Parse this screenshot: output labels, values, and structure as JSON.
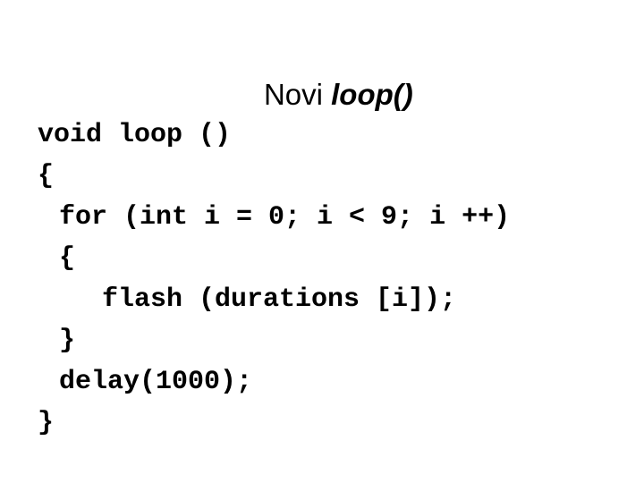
{
  "slide": {
    "title": {
      "plain_text": "Novi ",
      "emphasized_text": "loop()",
      "full_text": "Novi loop()"
    },
    "code": {
      "language": "arduino-c",
      "lines": [
        {
          "text": "void loop ()",
          "indent": 0
        },
        {
          "text": "{",
          "indent": 0
        },
        {
          "text": "for (int i = 0; i < 9; i ++)",
          "indent": 1
        },
        {
          "text": "{",
          "indent": 1
        },
        {
          "text": "flash (durations [i]);",
          "indent": 2
        },
        {
          "text": "}",
          "indent": 1
        },
        {
          "text": "delay(1000);",
          "indent": 1
        },
        {
          "text": "}",
          "indent": 0
        }
      ]
    },
    "colors": {
      "background": "#ffffff",
      "text": "#000000"
    }
  }
}
